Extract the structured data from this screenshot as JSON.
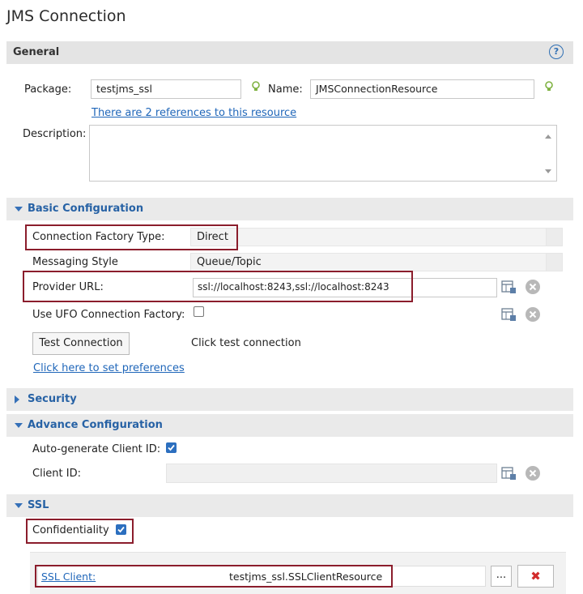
{
  "window": {
    "title": "JMS Connection"
  },
  "general": {
    "header": "General",
    "help_glyph": "?",
    "package_label": "Package:",
    "package_value": "testjms_ssl",
    "name_label": "Name:",
    "name_value": "JMSConnectionResource",
    "references_link": "There are 2 references to this resource",
    "description_label": "Description:",
    "description_value": ""
  },
  "basic": {
    "header": "Basic Configuration",
    "factory_type_label": "Connection Factory Type:",
    "factory_type_value": "Direct",
    "messaging_style_label": "Messaging Style",
    "messaging_style_value": "Queue/Topic",
    "provider_url_label": "Provider URL:",
    "provider_url_value": "ssl://localhost:8243,ssl://localhost:8243",
    "ufo_label": "Use UFO Connection Factory:",
    "ufo_checked": false,
    "test_button": "Test Connection",
    "test_status": "Click test connection",
    "preferences_link": "Click here to set preferences"
  },
  "security": {
    "header": "Security"
  },
  "advance": {
    "header": "Advance Configuration",
    "autogen_label": "Auto-generate Client ID:",
    "autogen_checked": true,
    "client_id_label": "Client ID:",
    "client_id_value": ""
  },
  "ssl": {
    "header": "SSL",
    "confidentiality_label": "Confidentiality",
    "confidentiality_checked": true,
    "ssl_client_link": "SSL Client:",
    "ssl_client_value": "testjms_ssl.SSLClientResource",
    "browse_button": "...",
    "delete_glyph": "✖"
  },
  "colors": {
    "accent": "#2762a5",
    "highlight_box": "#8b1d2c",
    "delete_red": "#d22b2b",
    "bulb_green": "#7fb241"
  }
}
